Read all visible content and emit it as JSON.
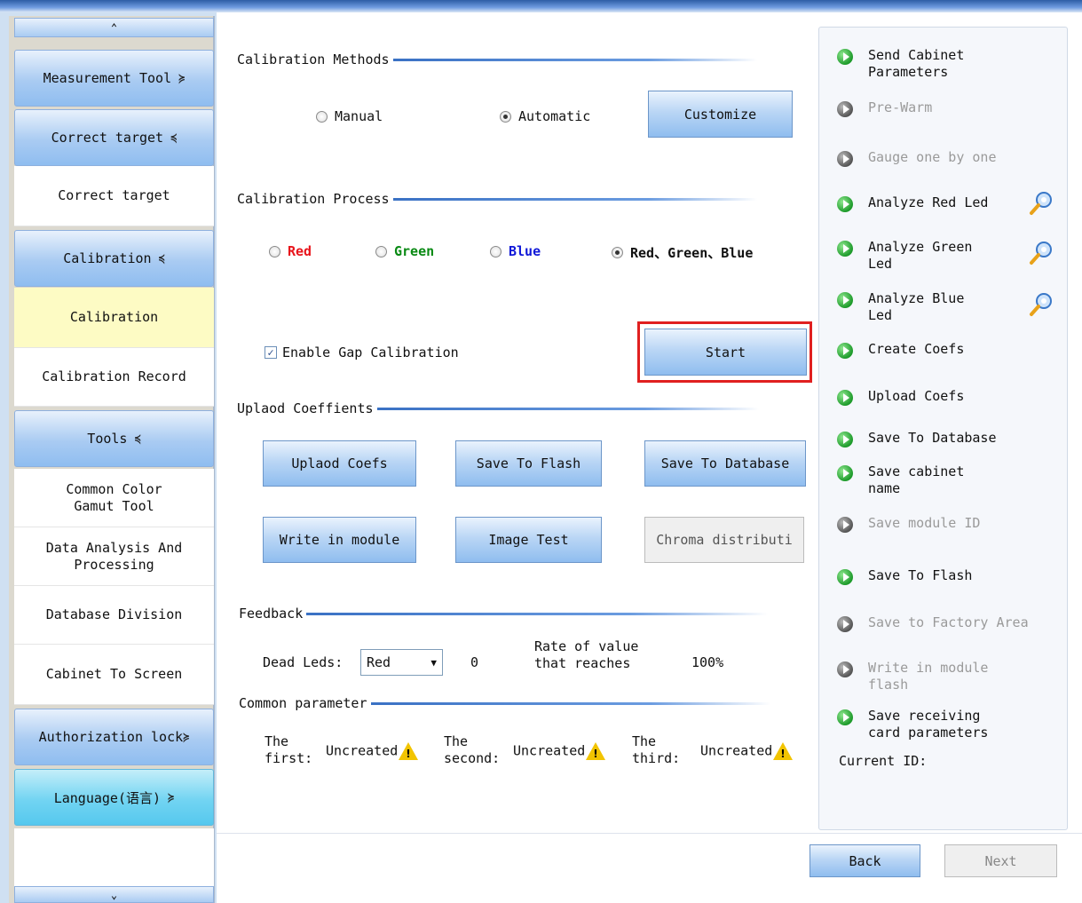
{
  "sidebar": {
    "scroll_up": "⌃",
    "scroll_down": "⌄",
    "groups": [
      {
        "label": "Measurement Tool",
        "chev": "≽"
      },
      {
        "label": "Correct target",
        "chev": "≼"
      },
      {
        "label": "Calibration",
        "chev": "≼"
      },
      {
        "label": "Tools",
        "chev": "≼"
      },
      {
        "label": "Authorization lock",
        "chev": "≽"
      },
      {
        "label": "Language(语言)",
        "chev": "≽"
      }
    ],
    "items": {
      "correct_target": "Correct target",
      "calibration": "Calibration",
      "calibration_record": "Calibration Record",
      "common_color": "Common Color Gamut Tool",
      "data_analysis": "Data Analysis And Processing",
      "database_division": "Database Division",
      "cabinet_to_screen": "Cabinet To Screen"
    }
  },
  "methods": {
    "title": "Calibration Methods",
    "manual": "Manual",
    "automatic": "Automatic",
    "selected": "Automatic",
    "customize": "Customize"
  },
  "process": {
    "title": "Calibration Process",
    "options": [
      {
        "label": "Red",
        "color": "#e8141b"
      },
      {
        "label": "Green",
        "color": "#0a8a14"
      },
      {
        "label": "Blue",
        "color": "#1018d8"
      },
      {
        "label": "Red、Green、Blue",
        "color": "#111111"
      }
    ],
    "selected": "Red、Green、Blue",
    "gap_label": "Enable Gap Calibration",
    "gap_checked": true,
    "start": "Start"
  },
  "upload": {
    "title": "Uplaod Coeffients",
    "buttons": {
      "upload_coefs": "Uplaod Coefs",
      "save_flash": "Save To Flash",
      "save_db": "Save To Database",
      "write_module": "Write in module",
      "image_test": "Image Test",
      "chroma": "Chroma distributi"
    }
  },
  "feedback": {
    "title": "Feedback",
    "dead_leds_label": "Dead Leds:",
    "dead_leds_value": "Red",
    "dead_count": "0",
    "rate_label_1": "Rate of value",
    "rate_label_2": "that reaches",
    "rate_value": "100%"
  },
  "common": {
    "title": "Common parameter",
    "first_1": "The",
    "first_2": "first:",
    "second_1": "The",
    "second_2": "second:",
    "third_1": "The",
    "third_2": "third:",
    "uncreated": "Uncreated"
  },
  "steps": [
    {
      "l1": "Send Cabinet",
      "l2": "Parameters",
      "state": "active"
    },
    {
      "l1": "Pre-Warm",
      "l2": "",
      "state": "disabled"
    },
    {
      "l1": "Gauge one by one",
      "l2": "",
      "state": "disabled"
    },
    {
      "l1": "Analyze Red Led",
      "l2": "",
      "state": "active"
    },
    {
      "l1": "Analyze Green",
      "l2": "Led",
      "state": "active"
    },
    {
      "l1": "Analyze Blue",
      "l2": "Led",
      "state": "active"
    },
    {
      "l1": "Create Coefs",
      "l2": "",
      "state": "active"
    },
    {
      "l1": "Upload Coefs",
      "l2": "",
      "state": "active"
    },
    {
      "l1": "Save To Database",
      "l2": "",
      "state": "active"
    },
    {
      "l1": "Save cabinet",
      "l2": "name",
      "state": "active"
    },
    {
      "l1": "Save module ID",
      "l2": "",
      "state": "disabled"
    },
    {
      "l1": "Save To Flash",
      "l2": "",
      "state": "active"
    },
    {
      "l1": "Save to Factory Area",
      "l2": "",
      "state": "disabled"
    },
    {
      "l1": "Write in module",
      "l2": "flash",
      "state": "disabled"
    },
    {
      "l1": "Save receiving",
      "l2": "card parameters",
      "state": "active"
    }
  ],
  "current_id_label": "Current ID:",
  "nav": {
    "back": "Back",
    "next": "Next"
  }
}
